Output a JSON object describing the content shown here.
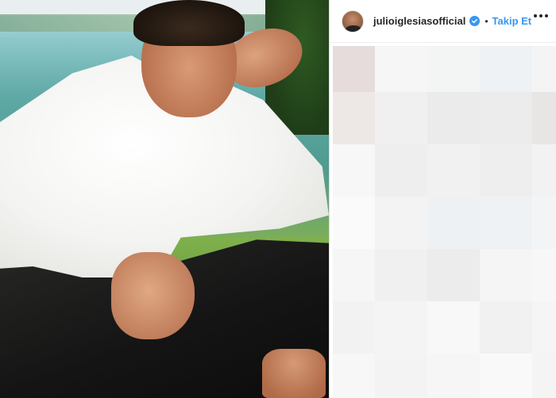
{
  "post": {
    "username": "julioiglesiasofficial",
    "verified": true,
    "separator": "•",
    "follow_label": "Takip Et",
    "more_icon": "more-horizontal-icon"
  },
  "colors": {
    "follow_blue": "#3897f0",
    "text_dark": "#262626",
    "divider": "#dbdbdb"
  }
}
